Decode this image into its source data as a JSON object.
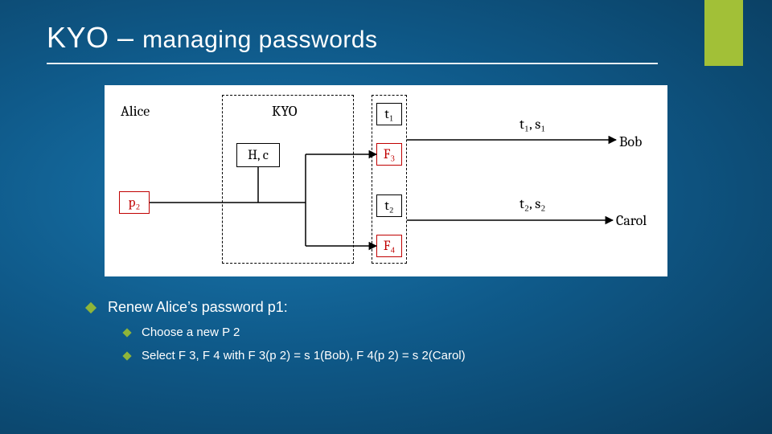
{
  "accent_color": "#a2c037",
  "title": {
    "prefix": "KYO – ",
    "rest": "managing passwords"
  },
  "diagram": {
    "alice": "Alice",
    "bob": "Bob",
    "carol": "Carol",
    "kyo": "KYO",
    "p2": "p₂",
    "Hc": "H, c",
    "t1": "t₁",
    "t2": "t₂",
    "F3": "F₃",
    "F4": "F₄",
    "out1": "t₁, s₁",
    "out2": "t₂, s₂"
  },
  "bullets": {
    "main": "Renew Alice’s password p1:",
    "sub1": "Choose a new P 2",
    "sub2": "Select F 3, F 4 with F 3(p 2) = s 1(Bob), F 4(p 2) = s 2(Carol)"
  }
}
